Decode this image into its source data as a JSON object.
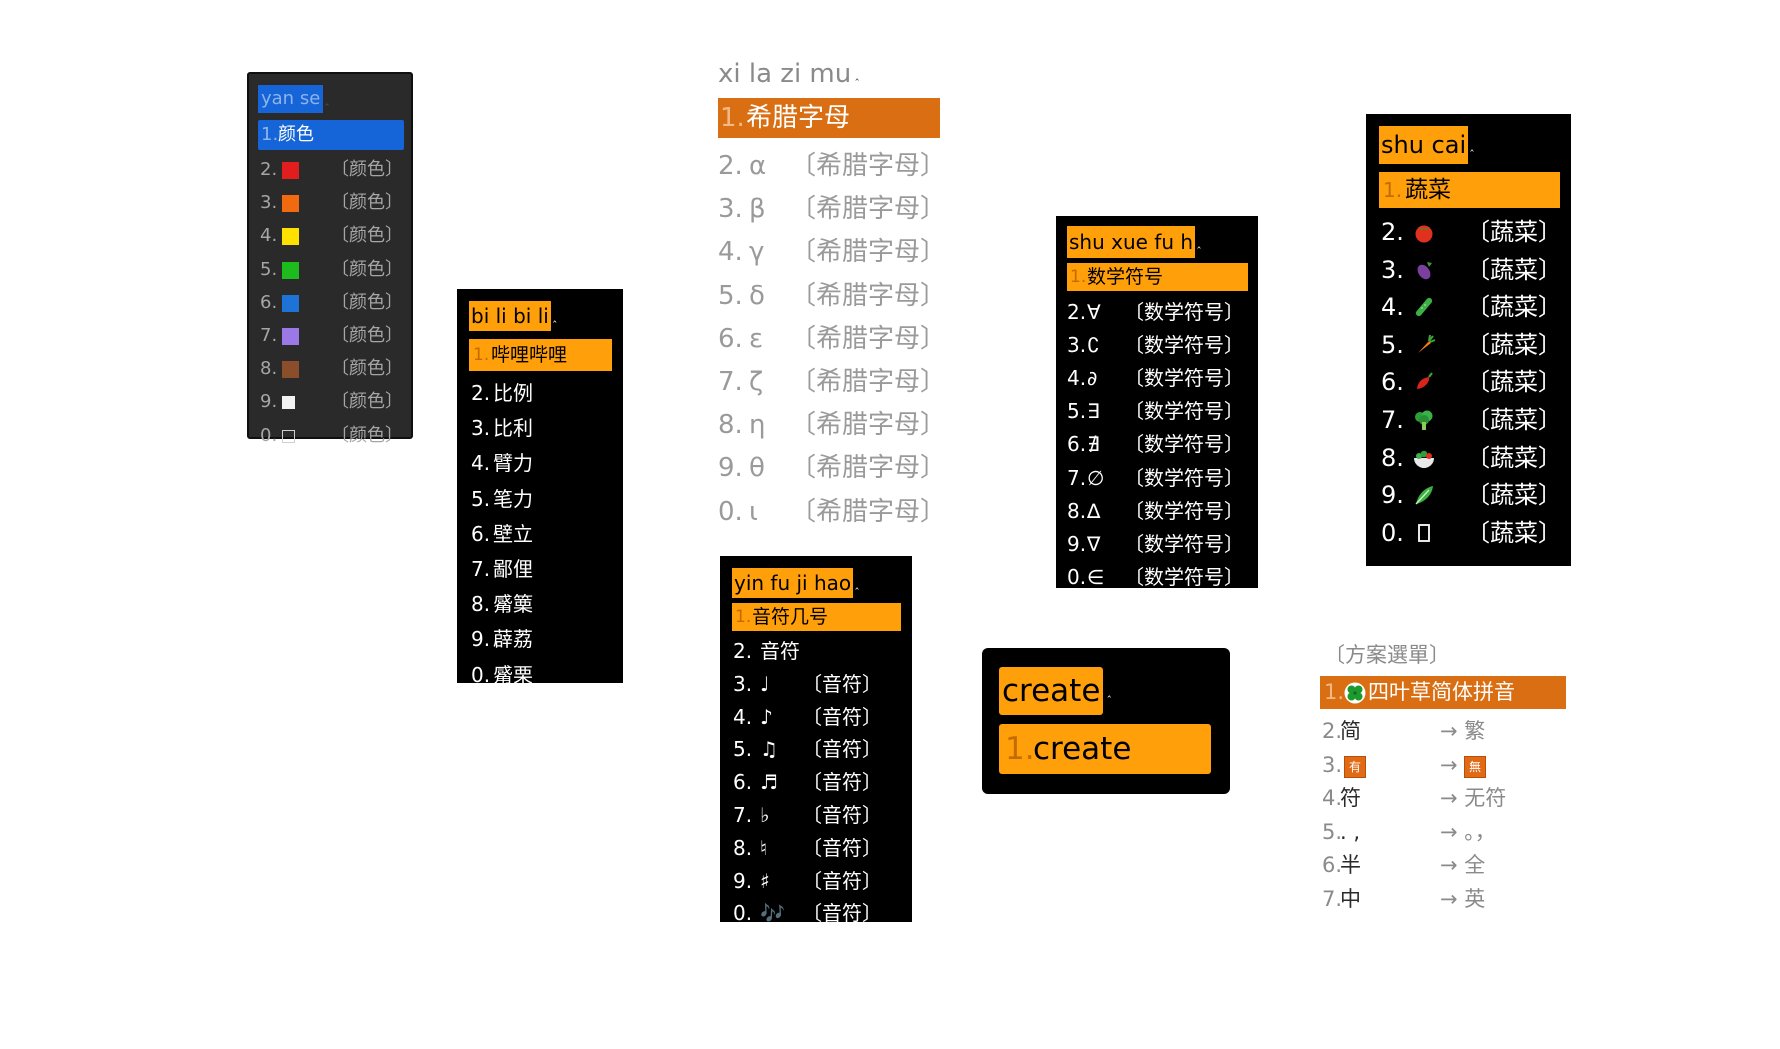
{
  "colors_panel": {
    "preedit": "yan se",
    "highlighted": {
      "num": "1.",
      "text": "颜色"
    },
    "rows": [
      {
        "num": "2.",
        "color": "#e21d1d",
        "comment": "〔颜色〕"
      },
      {
        "num": "3.",
        "color": "#f26a10",
        "comment": "〔颜色〕"
      },
      {
        "num": "4.",
        "color": "#ffe100",
        "comment": "〔颜色〕"
      },
      {
        "num": "5.",
        "color": "#1dbb1d",
        "comment": "〔颜色〕"
      },
      {
        "num": "6.",
        "color": "#1e74d6",
        "comment": "〔颜色〕"
      },
      {
        "num": "7.",
        "color": "#9a78e6",
        "comment": "〔颜色〕"
      },
      {
        "num": "8.",
        "color": "#8a4f2a",
        "comment": "〔颜色〕"
      },
      {
        "num": "9.",
        "color": "#f2f2f2",
        "comment": "〔颜色〕"
      },
      {
        "num": "0.",
        "color": "#2a2a2a",
        "comment": "〔颜色〕"
      }
    ]
  },
  "bili_panel": {
    "preedit": "bi li bi li",
    "highlighted": {
      "num": "1.",
      "text": "哔哩哔哩"
    },
    "rows": [
      {
        "num": "2.",
        "text": "比例"
      },
      {
        "num": "3.",
        "text": "比利"
      },
      {
        "num": "4.",
        "text": "臂力"
      },
      {
        "num": "5.",
        "text": "笔力"
      },
      {
        "num": "6.",
        "text": "壁立"
      },
      {
        "num": "7.",
        "text": "鄙俚"
      },
      {
        "num": "8.",
        "text": "觱篥"
      },
      {
        "num": "9.",
        "text": "薜荔"
      },
      {
        "num": "0.",
        "text": "觱栗"
      }
    ]
  },
  "greek_panel": {
    "preedit": "xi la zi mu",
    "highlighted": {
      "num": "1.",
      "text": "希腊字母"
    },
    "rows": [
      {
        "num": "2.",
        "text": "α",
        "comment": "〔希腊字母〕"
      },
      {
        "num": "3.",
        "text": "β",
        "comment": "〔希腊字母〕"
      },
      {
        "num": "4.",
        "text": "γ",
        "comment": "〔希腊字母〕"
      },
      {
        "num": "5.",
        "text": "δ",
        "comment": "〔希腊字母〕"
      },
      {
        "num": "6.",
        "text": "ε",
        "comment": "〔希腊字母〕"
      },
      {
        "num": "7.",
        "text": "ζ",
        "comment": "〔希腊字母〕"
      },
      {
        "num": "8.",
        "text": "η",
        "comment": "〔希腊字母〕"
      },
      {
        "num": "9.",
        "text": "θ",
        "comment": "〔希腊字母〕"
      },
      {
        "num": "0.",
        "text": "ι",
        "comment": "〔希腊字母〕"
      }
    ]
  },
  "yinfu_panel": {
    "preedit": "yin fu ji hao",
    "highlighted": {
      "num": "1.",
      "text": "音符几号"
    },
    "rows": [
      {
        "num": "2.",
        "text": "音符",
        "comment": ""
      },
      {
        "num": "3.",
        "text": "♩",
        "comment": "〔音符〕"
      },
      {
        "num": "4.",
        "text": "♪",
        "comment": "〔音符〕"
      },
      {
        "num": "5.",
        "text": "♫",
        "comment": "〔音符〕"
      },
      {
        "num": "6.",
        "text": "♬",
        "comment": "〔音符〕"
      },
      {
        "num": "7.",
        "text": "♭",
        "comment": "〔音符〕"
      },
      {
        "num": "8.",
        "text": "♮",
        "comment": "〔音符〕"
      },
      {
        "num": "9.",
        "text": "♯",
        "comment": "〔音符〕"
      },
      {
        "num": "0.",
        "text": "🎶",
        "comment": "〔音符〕"
      }
    ]
  },
  "shuxue_panel": {
    "preedit": "shu xue fu h",
    "highlighted": {
      "num": "1.",
      "text": "数学符号"
    },
    "rows": [
      {
        "num": "2.",
        "text": "∀",
        "comment": "〔数学符号〕"
      },
      {
        "num": "3.",
        "text": "∁",
        "comment": "〔数学符号〕"
      },
      {
        "num": "4.",
        "text": "∂",
        "comment": "〔数学符号〕"
      },
      {
        "num": "5.",
        "text": "∃",
        "comment": "〔数学符号〕"
      },
      {
        "num": "6.",
        "text": "∄",
        "comment": "〔数学符号〕"
      },
      {
        "num": "7.",
        "text": "∅",
        "comment": "〔数学符号〕"
      },
      {
        "num": "8.",
        "text": "∆",
        "comment": "〔数学符号〕"
      },
      {
        "num": "9.",
        "text": "∇",
        "comment": "〔数学符号〕"
      },
      {
        "num": "0.",
        "text": "∈",
        "comment": "〔数学符号〕"
      }
    ]
  },
  "create_panel": {
    "preedit": "create",
    "highlighted": {
      "num": "1.",
      "text": "create"
    }
  },
  "shucai_panel": {
    "preedit": "shu cai",
    "highlighted": {
      "num": "1.",
      "text": "蔬菜"
    },
    "rows": [
      {
        "num": "2.",
        "icon": "tomato-icon",
        "comment": "〔蔬菜〕"
      },
      {
        "num": "3.",
        "icon": "eggplant-icon",
        "comment": "〔蔬菜〕"
      },
      {
        "num": "4.",
        "icon": "cucumber-icon",
        "comment": "〔蔬菜〕"
      },
      {
        "num": "5.",
        "icon": "carrot-icon",
        "comment": "〔蔬菜〕"
      },
      {
        "num": "6.",
        "icon": "hot-pepper-icon",
        "comment": "〔蔬菜〕"
      },
      {
        "num": "7.",
        "icon": "broccoli-icon",
        "comment": "〔蔬菜〕"
      },
      {
        "num": "8.",
        "icon": "salad-icon",
        "comment": "〔蔬菜〕"
      },
      {
        "num": "9.",
        "icon": "leafy-green-icon",
        "comment": "〔蔬菜〕"
      },
      {
        "num": "0.",
        "icon": "missing-glyph-icon",
        "comment": "〔蔬菜〕"
      }
    ]
  },
  "schema_menu": {
    "title": "〔方案選單〕",
    "highlighted": {
      "num": "1.",
      "icon": "four-leaf-clover-icon",
      "text": "四叶草简体拼音"
    },
    "rows": [
      {
        "num": "2.",
        "text": "简",
        "comment": "→ 繁"
      },
      {
        "num": "3.",
        "badge": "有",
        "arrow": "→",
        "badge2": "無"
      },
      {
        "num": "4.",
        "text": "符",
        "comment": "→ 无符"
      },
      {
        "num": "5.",
        "text": ". ,",
        "comment": "→ 。，"
      },
      {
        "num": "6.",
        "text": "半",
        "comment": "→ 全"
      },
      {
        "num": "7.",
        "text": "中",
        "comment": "→ 英"
      }
    ]
  },
  "colors": {
    "accent_orange": "#ff9f0a",
    "accent_dark_orange": "#d96e13",
    "accent_blue": "#1565d8"
  }
}
